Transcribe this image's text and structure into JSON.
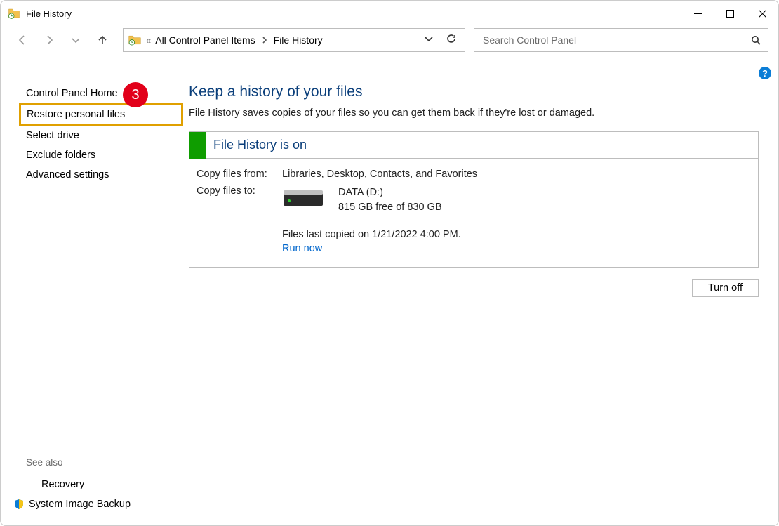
{
  "window": {
    "title": "File History"
  },
  "address": {
    "crumb1": "All Control Panel Items",
    "crumb2": "File History"
  },
  "search": {
    "placeholder": "Search Control Panel"
  },
  "sidebar": {
    "home": "Control Panel Home",
    "restore": "Restore personal files",
    "select_drive": "Select drive",
    "exclude": "Exclude folders",
    "advanced": "Advanced settings"
  },
  "callout": {
    "number": "3"
  },
  "see_also": {
    "header": "See also",
    "recovery": "Recovery",
    "system_image": "System Image Backup"
  },
  "page": {
    "title": "Keep a history of your files",
    "subtitle": "File History saves copies of your files so you can get them back if they're lost or damaged."
  },
  "panel": {
    "status": "File History is on",
    "copy_from_label": "Copy files from:",
    "copy_from_value": "Libraries, Desktop, Contacts, and Favorites",
    "copy_to_label": "Copy files to:",
    "drive_name": "DATA (D:)",
    "drive_space": "815 GB free of 830 GB",
    "last_copy": "Files last copied on 1/21/2022 4:00 PM.",
    "run_now": "Run now"
  },
  "buttons": {
    "turn_off": "Turn off"
  },
  "help": {
    "symbol": "?"
  }
}
